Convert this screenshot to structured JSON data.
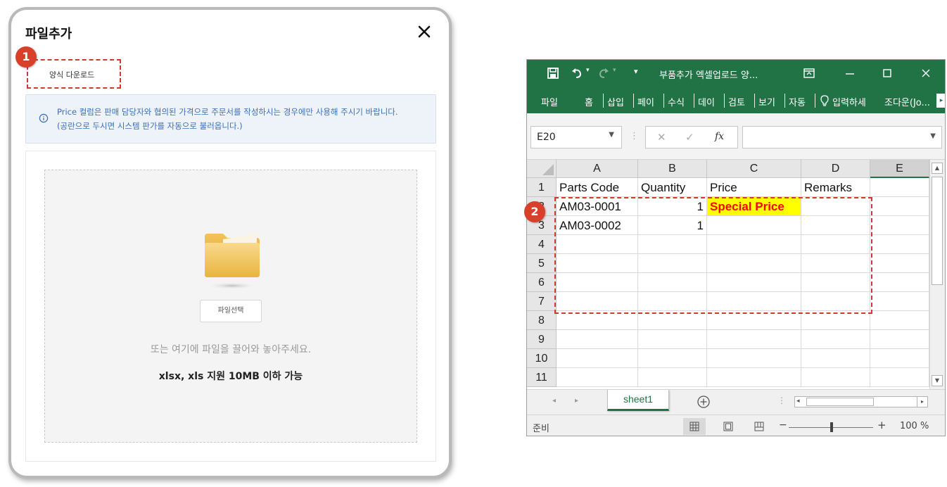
{
  "modal": {
    "title": "파일추가",
    "template_download_label": "양식 다운로드",
    "notice_line1": "Price 컬럼은 판매 담당자와 협의된 가격으로 주문서를 작성하시는 경우에만 사용해 주시기 바랍니다.",
    "notice_line2": "(공란으로 두시면 시스템 판가를 자동으로 불러옵니다.)",
    "select_file_label": "파일선택",
    "drop_hint": "또는 여기에 파일을 끌어와 놓아주세요.",
    "file_limit": "xlsx, xls 지원 10MB 이하 가능"
  },
  "badges": {
    "one": "1",
    "two": "2"
  },
  "excel": {
    "window_title": "부품추가 엑셀업로드 양...",
    "ribbon_tabs": [
      "파일",
      "홈",
      "삽입",
      "페이",
      "수식",
      "데이",
      "검토",
      "보기",
      "자동"
    ],
    "tell_me": "입력하세",
    "user_name": "조다운(Jo...",
    "name_box": "E20",
    "fx_label": "fx",
    "column_headers": [
      "A",
      "B",
      "C",
      "D",
      "E"
    ],
    "selected_column": "E",
    "row_numbers": [
      "1",
      "2",
      "3",
      "4",
      "5",
      "6",
      "7",
      "8",
      "9",
      "10",
      "11"
    ],
    "rows": [
      [
        "Parts Code",
        "Quantity",
        "Price",
        "Remarks",
        ""
      ],
      [
        "AM03-0001",
        "1",
        "Special Price",
        "",
        ""
      ],
      [
        "AM03-0002",
        "1",
        "",
        "",
        ""
      ]
    ],
    "sheet_tab": "sheet1",
    "status": "준비",
    "zoom": "100 %"
  },
  "colors": {
    "excel_green": "#217346",
    "badge_red": "#d8402c",
    "highlight_yellow": "#ffff00",
    "highlight_text": "#ff0000",
    "notice_blue": "#3a6fb5"
  }
}
